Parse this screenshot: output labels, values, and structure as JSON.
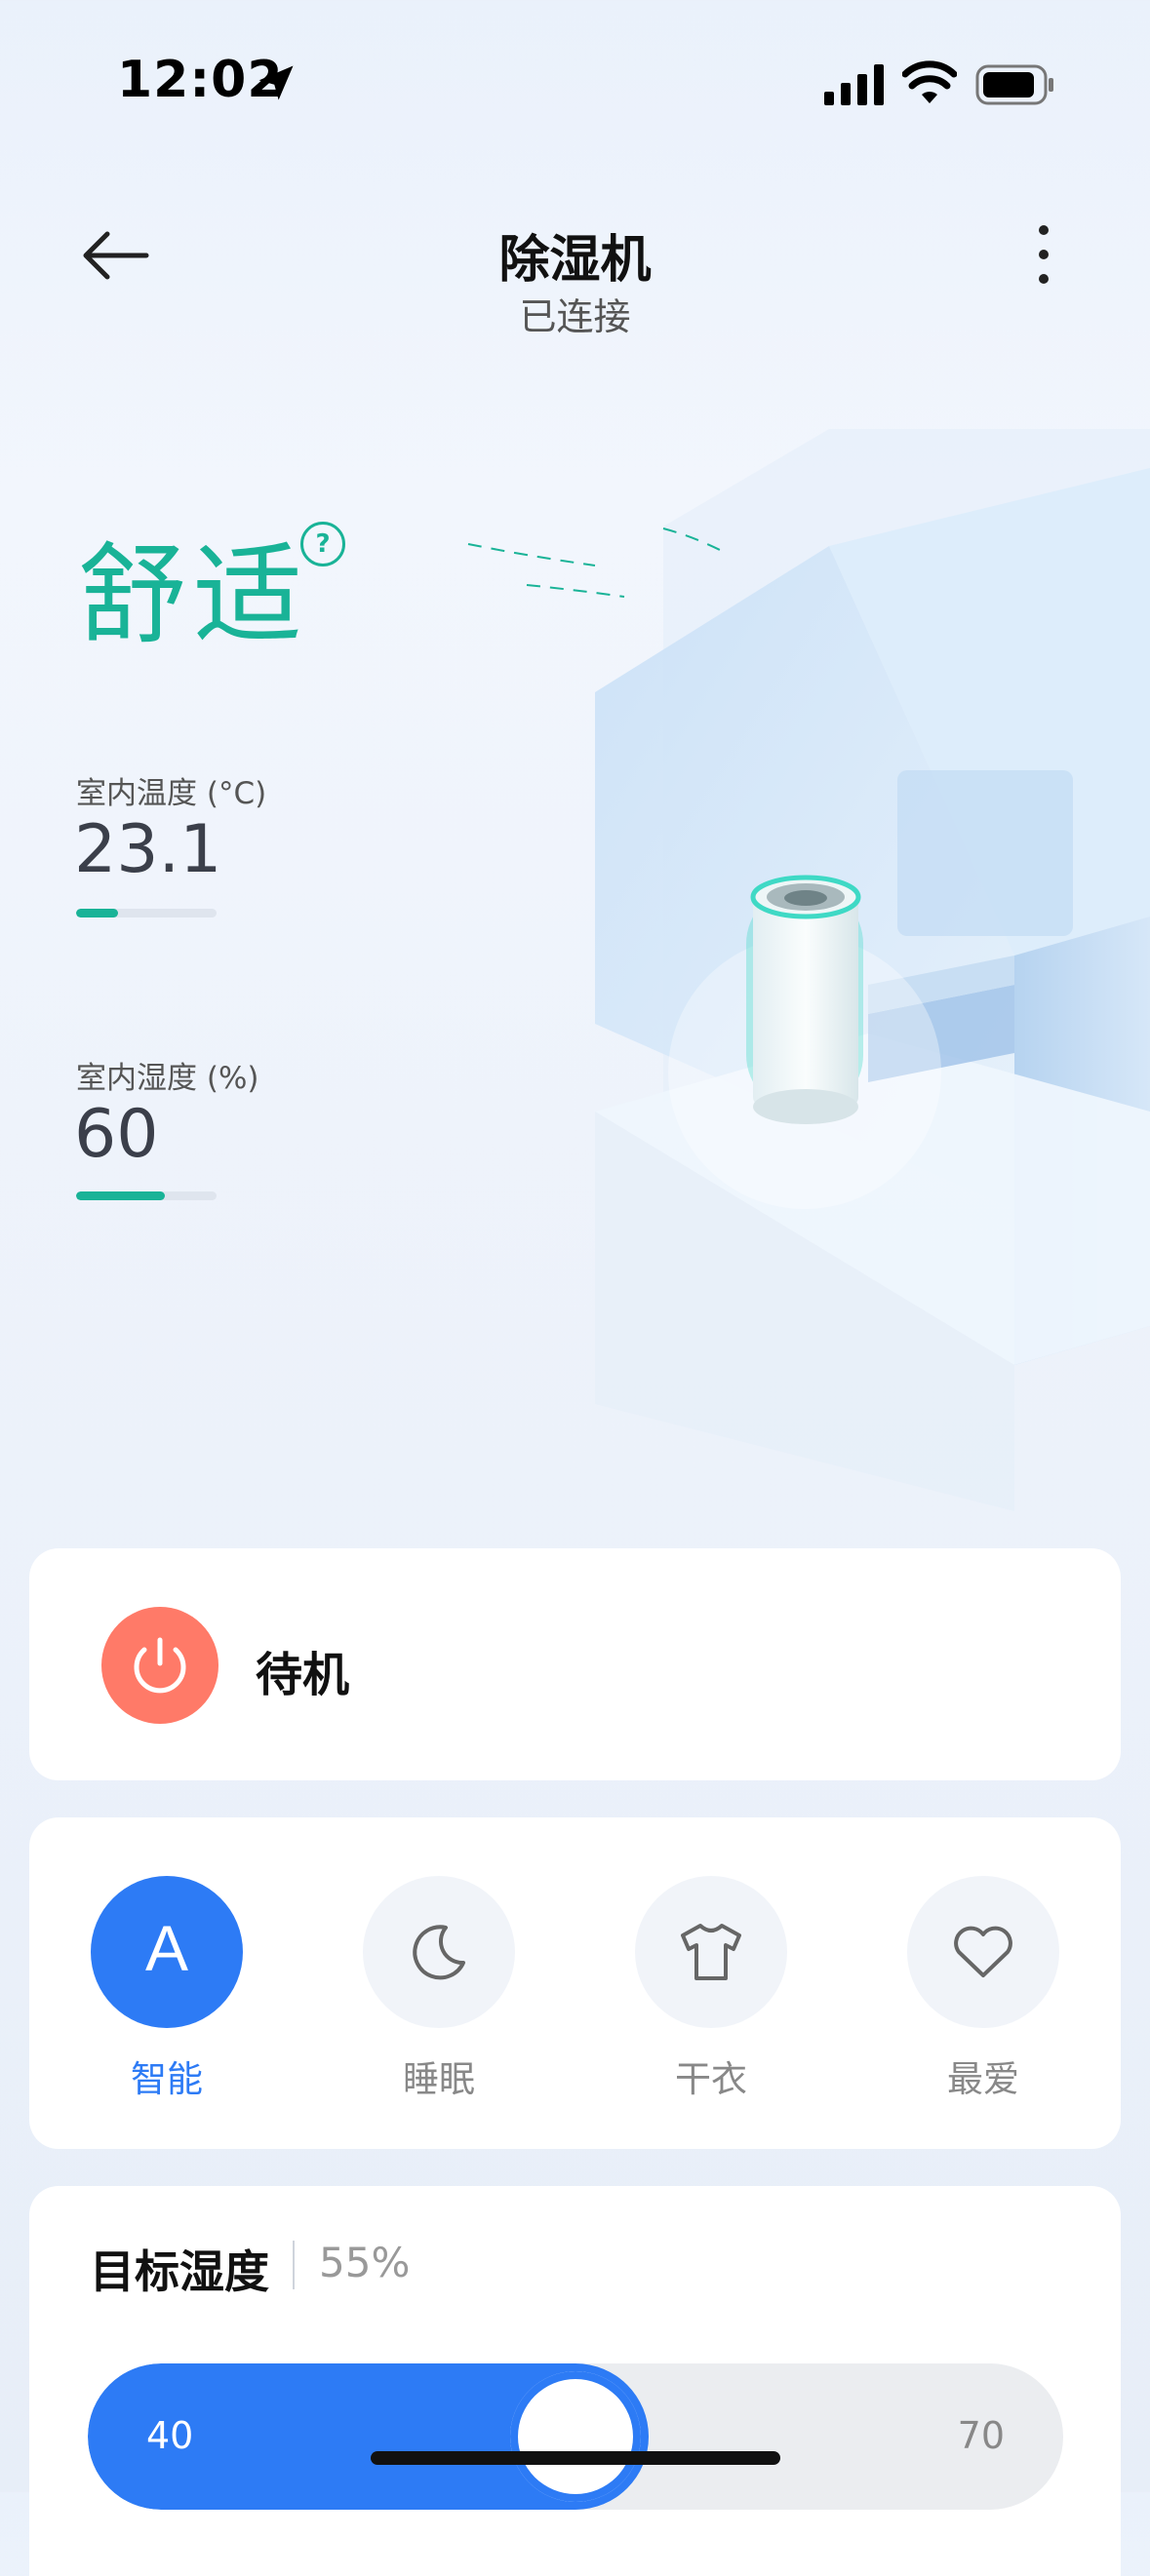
{
  "status_bar": {
    "time": "12:02"
  },
  "header": {
    "title": "除湿机",
    "subtitle": "已连接"
  },
  "hero": {
    "comfort_label": "舒适",
    "help_glyph": "?",
    "temperature": {
      "label": "室内温度 (°C)",
      "value": "23.1",
      "level": 0.3
    },
    "humidity": {
      "label": "室内湿度 (%)",
      "value": "60",
      "level": 0.63
    }
  },
  "power": {
    "label": "待机",
    "icon": "power-icon",
    "color": "#ff7a68"
  },
  "modes": [
    {
      "label": "智能",
      "glyph": "A",
      "icon": "auto-icon",
      "active": true
    },
    {
      "label": "睡眠",
      "icon": "moon-icon",
      "active": false
    },
    {
      "label": "干衣",
      "icon": "shirt-icon",
      "active": false
    },
    {
      "label": "最爱",
      "icon": "heart-icon",
      "active": false
    }
  ],
  "target_humidity": {
    "title": "目标湿度",
    "value_text": "55%",
    "min": "40",
    "max": "70",
    "value": 55
  },
  "colors": {
    "accent": "#2d7bf5",
    "comfort": "#19b397",
    "power": "#ff7a68"
  }
}
